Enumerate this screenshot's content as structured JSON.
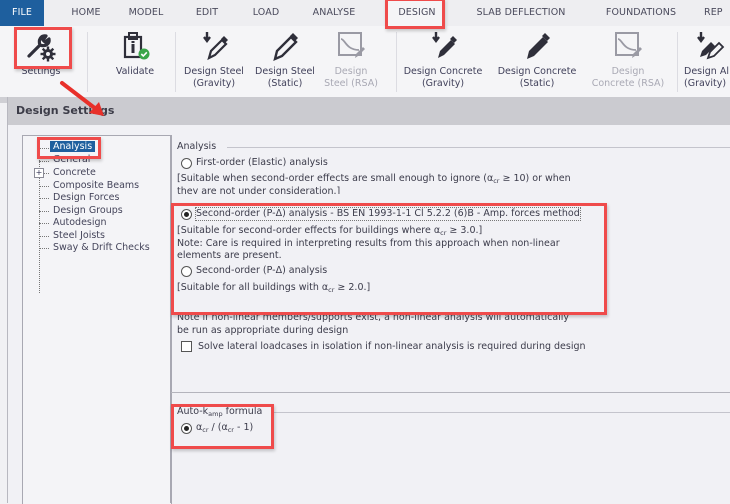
{
  "ribbon_tabs": [
    "FILE",
    "HOME",
    "MODEL",
    "EDIT",
    "LOAD",
    "ANALYSE",
    "DESIGN",
    "SLAB DEFLECTION",
    "FOUNDATIONS",
    "REP"
  ],
  "active_tab": "DESIGN",
  "ribbon_buttons": [
    {
      "label1": "Settings",
      "label2": "",
      "icon": "wrench-gear-icon",
      "enabled": true
    },
    {
      "label1": "Validate",
      "label2": "",
      "icon": "clipboard-check-icon",
      "enabled": true
    },
    {
      "label1": "Design Steel",
      "label2": "(Gravity)",
      "icon": "pencil-down-arrow-icon",
      "enabled": true
    },
    {
      "label1": "Design Steel",
      "label2": "(Static)",
      "icon": "pencil-icon",
      "enabled": true
    },
    {
      "label1": "Design",
      "label2": "Steel (RSA)",
      "icon": "chart-pencil-icon",
      "enabled": false
    },
    {
      "label1": "Design Concrete",
      "label2": "(Gravity)",
      "icon": "pencil-down-arrow-icon",
      "enabled": true
    },
    {
      "label1": "Design Concrete",
      "label2": "(Static)",
      "icon": "pencil-icon",
      "enabled": true
    },
    {
      "label1": "Design",
      "label2": "Concrete (RSA)",
      "icon": "chart-pencil-icon",
      "enabled": false
    },
    {
      "label1": "Design Al",
      "label2": "(Gravity)",
      "icon": "double-pencil-down-arrow-icon",
      "enabled": true
    }
  ],
  "dialog": {
    "title": "Design Settings",
    "tree": [
      {
        "label": "Analysis",
        "selected": true,
        "expandable": false
      },
      {
        "label": "General",
        "selected": false,
        "expandable": false
      },
      {
        "label": "Concrete",
        "selected": false,
        "expandable": true
      },
      {
        "label": "Composite Beams",
        "selected": false,
        "expandable": false
      },
      {
        "label": "Design Forces",
        "selected": false,
        "expandable": false
      },
      {
        "label": "Design Groups",
        "selected": false,
        "expandable": false
      },
      {
        "label": "Autodesign",
        "selected": false,
        "expandable": false
      },
      {
        "label": "Steel Joists",
        "selected": false,
        "expandable": false
      },
      {
        "label": "Sway & Drift Checks",
        "selected": false,
        "expandable": false
      }
    ],
    "analysis_group": {
      "title": "Analysis",
      "option1": "First-order (Elastic) analysis",
      "option1_note_a": "[Suitable when second-order effects are small enough to ignore (α",
      "option1_note_sub": "cr",
      "option1_note_b": " ≥ 10) or when",
      "option1_note_line2": "they are not under consideration.]",
      "option2": "Second-order (P-Δ) analysis - BS EN 1993-1-1 Cl 5.2.2 (6)B - Amp. forces method",
      "option2_note_a": "[Suitable for second-order effects for buildings where α",
      "option2_note_sub": "cr",
      "option2_note_b": " ≥ 3.0.]",
      "option2_note_line2": "Note: Care is required in interpreting results from this approach when non-linear",
      "option2_note_line3": "elements are present.",
      "option3": "Second-order (P-Δ) analysis",
      "option3_note_a": "[Suitable for all buildings with α",
      "option3_note_sub": "cr",
      "option3_note_b": " ≥ 2.0.]",
      "nonlinear_note_1": "Note if non-linear members/supports exist, a non-linear analysis will automatically",
      "nonlinear_note_2": "be run as appropriate during design",
      "checkbox_label": "Solve lateral loadcases in isolation if non-linear analysis is required during design",
      "checkbox_checked": false,
      "selected_option": 2
    },
    "kamp_group": {
      "title_a": "Auto-k",
      "title_sub": "amp",
      "title_b": " formula",
      "option_a": "α",
      "option_sub1": "cr",
      "option_b": " / (α",
      "option_sub2": "cr",
      "option_c": " - 1)",
      "selected": true
    }
  },
  "colors": {
    "highlight": "#ef4b4b",
    "file_tab": "#1e5f9e",
    "selection": "#1e5f9e"
  }
}
